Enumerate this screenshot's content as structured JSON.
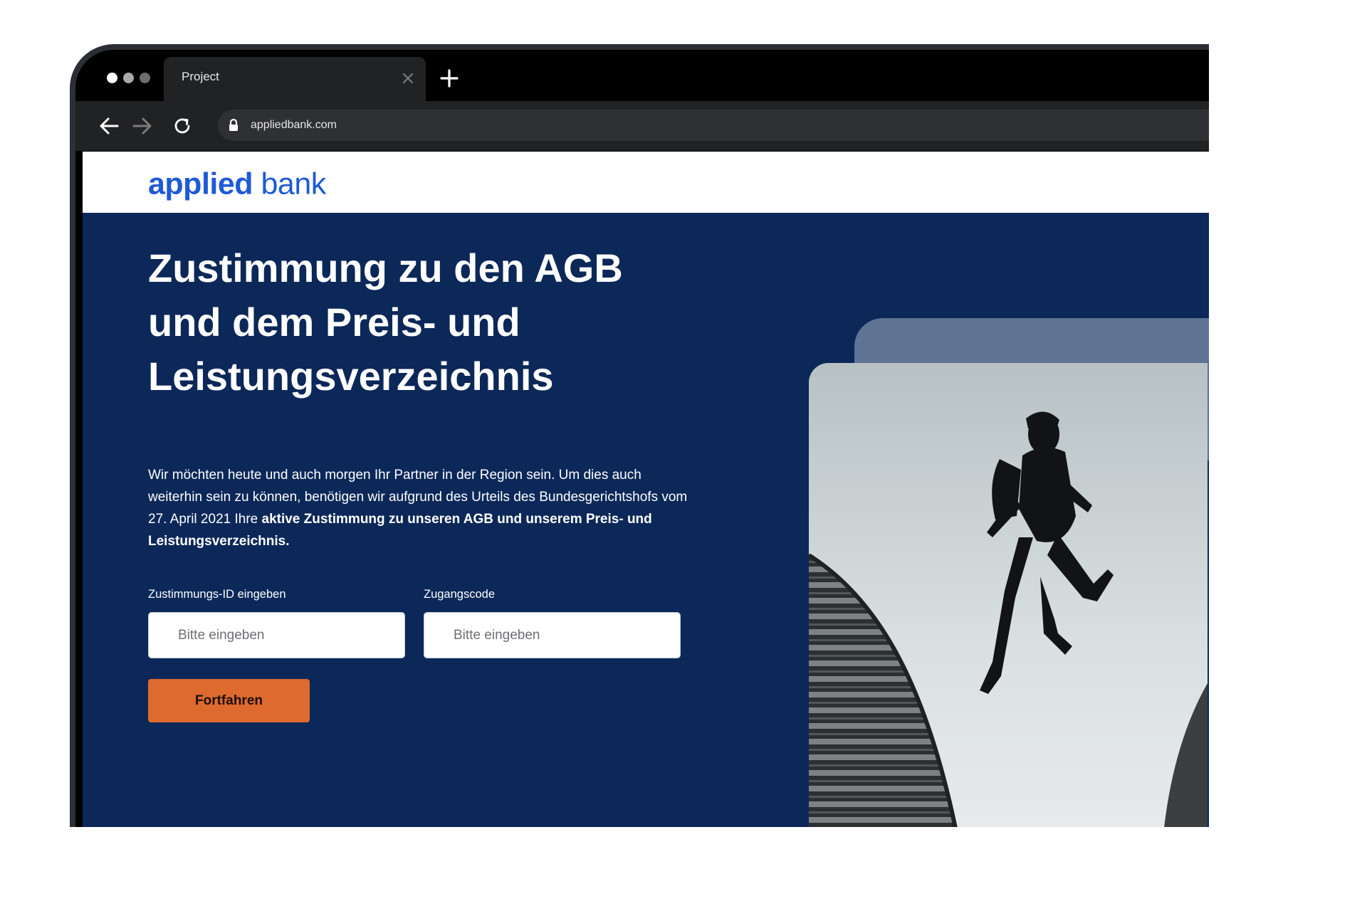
{
  "browser": {
    "tab": {
      "title": "Project"
    },
    "url": "appliedbank.com"
  },
  "site": {
    "logo": {
      "primary": "applied",
      "secondary": "bank"
    },
    "hero": {
      "title": "Zustimmung zu den AGB und dem Preis- und Leistungsverzeichnis",
      "intro_text": "Wir möchten heute und auch morgen Ihr Partner in der Region sein. Um dies auch weiterhin sein zu können, benötigen wir aufgrund des Urteils des Bundesgerichtshofs vom 27. April 2021 Ihre ",
      "intro_bold": "aktive Zustimmung zu unseren AGB und unserem Preis- und Leistungsverzeichnis."
    },
    "form": {
      "consent_id": {
        "label": "Zustimmungs-ID eingeben",
        "placeholder": "Bitte eingeben",
        "value": ""
      },
      "access_code": {
        "label": "Zugangscode",
        "placeholder": "Bitte eingeben",
        "value": ""
      },
      "submit_label": "Fortfahren"
    }
  },
  "colors": {
    "brand_blue": "#1e5ad6",
    "page_background": "#0c2859",
    "button": "#de6a2f",
    "image_backdrop": "#5f7394"
  },
  "icons": [
    "close-icon",
    "plus-icon",
    "arrow-left-icon",
    "arrow-right-icon",
    "reload-icon",
    "lock-icon"
  ]
}
